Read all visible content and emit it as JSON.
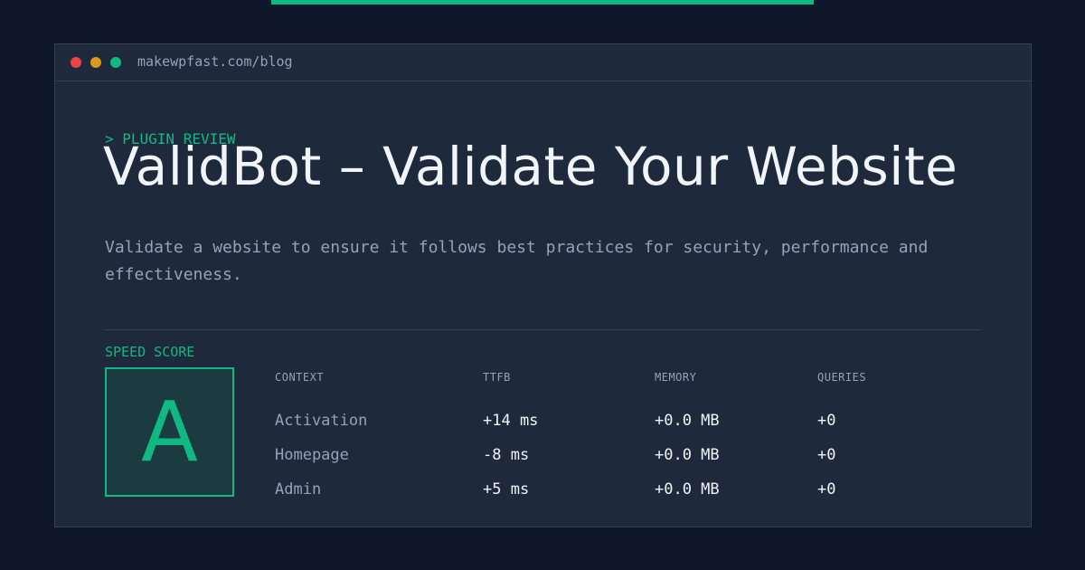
{
  "colors": {
    "background": "#0f172a",
    "panel": "#1e293b",
    "border": "#334155",
    "accent": "#10b981",
    "text_primary": "#f1f5f9",
    "text_secondary": "#94a3b8",
    "dot_red": "#ef4444",
    "dot_yellow": "#d99a1d",
    "dot_green": "#10b981"
  },
  "window": {
    "url": "makewpfast.com/blog"
  },
  "article": {
    "eyebrow": "> PLUGIN REVIEW",
    "title": "ValidBot – Validate Your Website",
    "description": "Validate a website to ensure it follows best practices for security, performance and effectiveness."
  },
  "score": {
    "label": "SPEED SCORE",
    "grade": "A"
  },
  "metrics": {
    "headers": [
      "CONTEXT",
      "TTFB",
      "MEMORY",
      "QUERIES"
    ],
    "rows": [
      {
        "context": "Activation",
        "ttfb": "+14 ms",
        "memory": "+0.0 MB",
        "queries": "+0"
      },
      {
        "context": "Homepage",
        "ttfb": "-8 ms",
        "memory": "+0.0 MB",
        "queries": "+0"
      },
      {
        "context": "Admin",
        "ttfb": "+5 ms",
        "memory": "+0.0 MB",
        "queries": "+0"
      }
    ]
  }
}
